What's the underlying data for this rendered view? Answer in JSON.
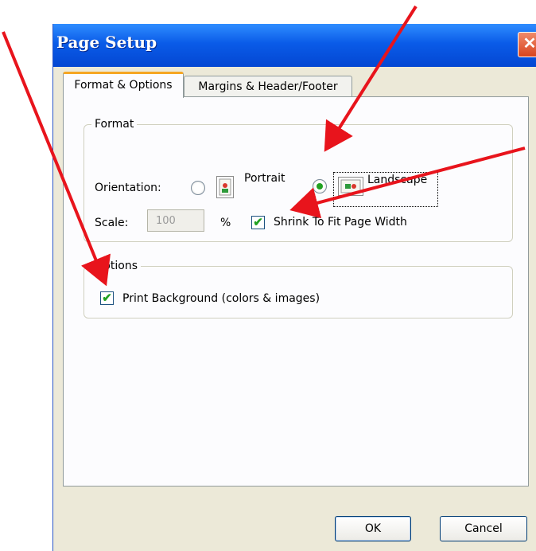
{
  "window": {
    "title": "Page Setup",
    "close_glyph": "✕"
  },
  "tabs": [
    {
      "label": "Format & Options",
      "active": true
    },
    {
      "label": "Margins & Header/Footer",
      "active": false
    }
  ],
  "format_group": {
    "label": "Format",
    "orientation_label": "Orientation:",
    "portrait_label": "Portrait",
    "landscape_label": "Landscape",
    "selected_orientation": "Landscape",
    "scale_label": "Scale:",
    "scale_value": "100",
    "percent_label": "%",
    "shrink_label": "Shrink To Fit Page Width",
    "shrink_checked": true
  },
  "options_group": {
    "label": "Options",
    "print_background_label": "Print Background (colors & images)",
    "print_background_checked": true
  },
  "buttons": {
    "ok": "OK",
    "cancel": "Cancel"
  },
  "colors": {
    "annotation_arrow": "#e8141c",
    "check": "#21a121",
    "titlebar": "#0a5be8"
  },
  "icons": {
    "portrait": "portrait-page-icon",
    "landscape": "landscape-page-icon"
  }
}
